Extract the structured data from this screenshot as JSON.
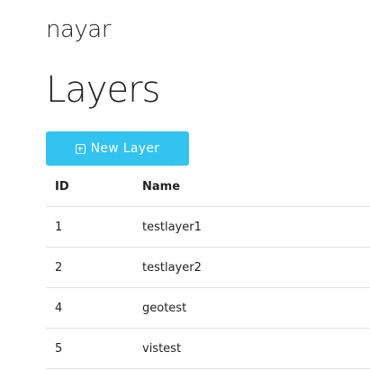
{
  "brand": "nayar",
  "title": "Layers",
  "new_button": {
    "label": "New Layer",
    "icon": "plus-square-icon",
    "color": "#33c3f0"
  },
  "table": {
    "headers": {
      "id": "ID",
      "name": "Name"
    },
    "rows": [
      {
        "id": "1",
        "name": "testlayer1"
      },
      {
        "id": "2",
        "name": "testlayer2"
      },
      {
        "id": "4",
        "name": "geotest"
      },
      {
        "id": "5",
        "name": "vistest"
      }
    ]
  }
}
